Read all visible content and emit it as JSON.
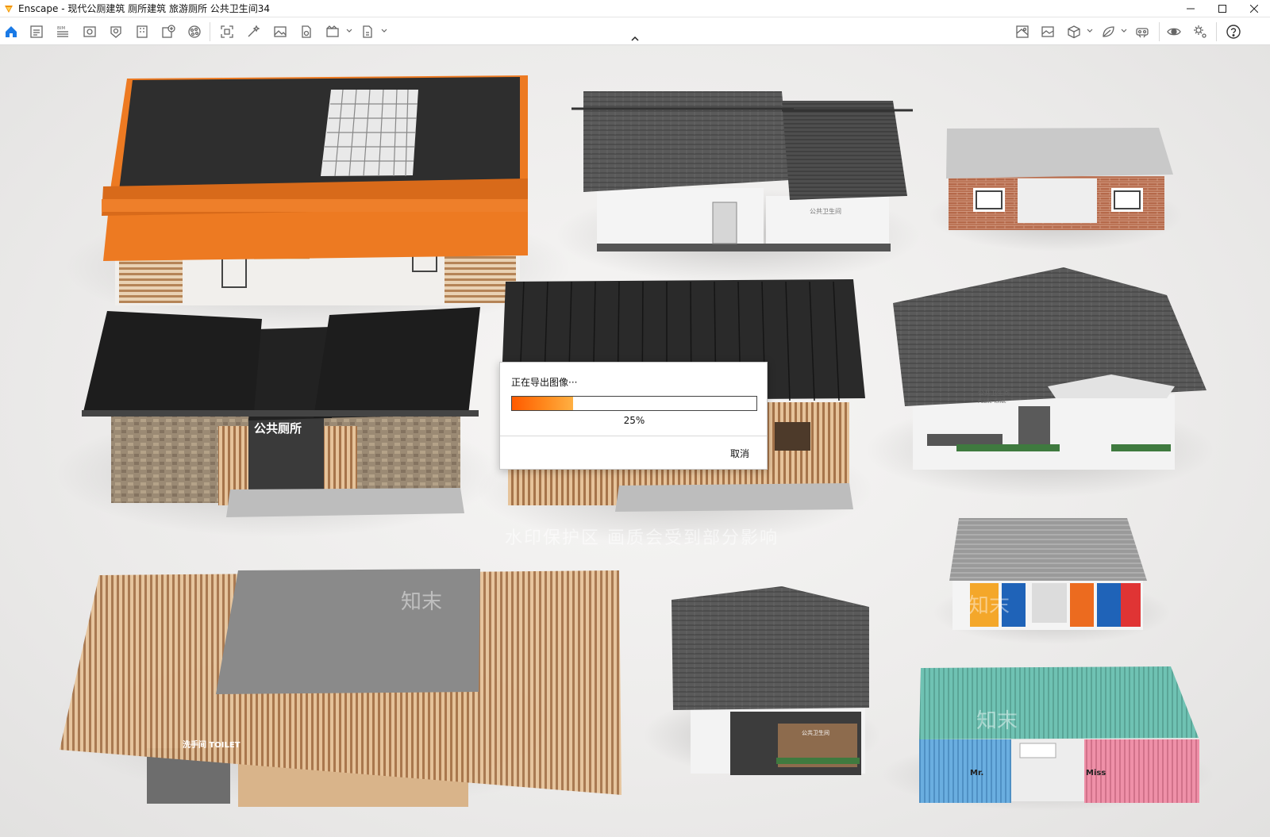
{
  "window": {
    "title": "Enscape - 现代公厕建筑 厕所建筑 旅游厕所 公共卫生间34",
    "controls": [
      "minimize",
      "maximize",
      "close"
    ]
  },
  "toolbar": {
    "left_icons": [
      "home-icon",
      "notes-icon",
      "bim-icon",
      "view-icon",
      "section-icon",
      "building-icon",
      "asset-add-icon",
      "material-icon",
      "screenshot-icon",
      "magic-wand-icon",
      "image-icon",
      "file-export-icon",
      "video-icon",
      "export-icon"
    ],
    "bim_label": "BIM",
    "right_icons": [
      "map-icon",
      "gallery-icon",
      "cube-icon",
      "leaf-icon",
      "vr-headset-icon",
      "eye-icon",
      "settings-icon",
      "help-icon"
    ]
  },
  "colors": {
    "accent": "#1a7ae6",
    "progress_start": "#ff5a00",
    "progress_end": "#ffb043"
  },
  "watermark": {
    "text": "水印保护区  画质会受到部分影响"
  },
  "dialog": {
    "title": "正在导出图像···",
    "progress_value": 0.25,
    "progress_text": "25%",
    "cancel_label": "取消"
  },
  "signs": {
    "gongce": "公共厕所",
    "toilet_label": "洗手间 TOILET",
    "public_toilet_cn": "公共卫生间",
    "public_toilet_en": "Public Toilet",
    "mr": "Mr.",
    "miss": "Miss",
    "brand": "知末"
  }
}
